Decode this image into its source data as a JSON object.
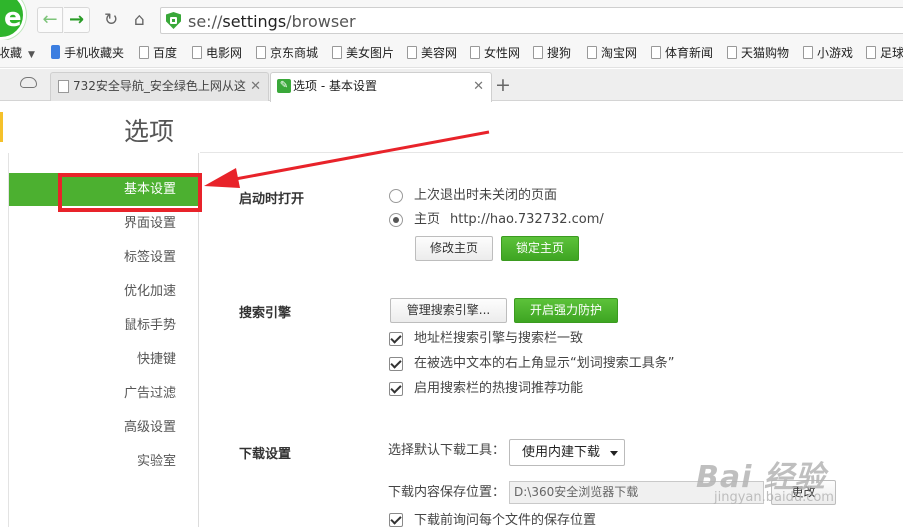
{
  "toolbar": {
    "address": {
      "scheme": "se://",
      "path": "settings",
      "rest": "/browser"
    }
  },
  "bookmarks": [
    {
      "label": "收藏",
      "icon": "none"
    },
    {
      "label": "手机收藏夹",
      "icon": "phone-icon"
    },
    {
      "label": "百度",
      "icon": "page-icon"
    },
    {
      "label": "电影网",
      "icon": "page-icon"
    },
    {
      "label": "京东商城",
      "icon": "page-icon"
    },
    {
      "label": "美女图片",
      "icon": "page-icon"
    },
    {
      "label": "美容网",
      "icon": "page-icon"
    },
    {
      "label": "女性网",
      "icon": "page-icon"
    },
    {
      "label": "搜狗",
      "icon": "page-icon"
    },
    {
      "label": "淘宝网",
      "icon": "page-icon"
    },
    {
      "label": "体育新闻",
      "icon": "page-icon"
    },
    {
      "label": "天猫购物",
      "icon": "page-icon"
    },
    {
      "label": "小游戏",
      "icon": "page-icon"
    },
    {
      "label": "足球",
      "icon": "page-icon"
    }
  ],
  "tabs": [
    {
      "label": "732安全导航_安全绿色上网从这",
      "active": false
    },
    {
      "label": "选项 - 基本设置",
      "active": true
    }
  ],
  "page": {
    "title": "选项"
  },
  "sidebar": {
    "items": [
      {
        "label": "基本设置",
        "active": true
      },
      {
        "label": "界面设置"
      },
      {
        "label": "标签设置"
      },
      {
        "label": "优化加速"
      },
      {
        "label": "鼠标手势"
      },
      {
        "label": "快捷键"
      },
      {
        "label": "广告过滤"
      },
      {
        "label": "高级设置"
      },
      {
        "label": "实验室"
      }
    ]
  },
  "startup": {
    "title": "启动时打开",
    "option_last": "上次退出时未关闭的页面",
    "option_home": "主页",
    "home_url": "http://hao.732732.com/",
    "btn_modify": "修改主页",
    "btn_lock": "锁定主页"
  },
  "search": {
    "title": "搜索引擎",
    "btn_manage": "管理搜索引擎...",
    "btn_protect": "开启强力防护",
    "check_1": "地址栏搜索引擎与搜索栏一致",
    "check_2": "在被选中文本的右上角显示“划词搜索工具条”",
    "check_3": "启用搜索栏的热搜词推荐功能"
  },
  "download": {
    "title": "下载设置",
    "tool_label": "选择默认下载工具：",
    "tool_value": "使用内建下载",
    "path_label": "下载内容保存位置：",
    "path_value": "D:\\360安全浏览器下载",
    "btn_change": "更改",
    "check_ask": "下载前询问每个文件的保存位置"
  },
  "watermark": {
    "main": "Bai 经验",
    "sub": "jingyan.baidu.com"
  },
  "colors": {
    "accent_green": "#4cb030",
    "annotation_red": "#e8232a"
  }
}
